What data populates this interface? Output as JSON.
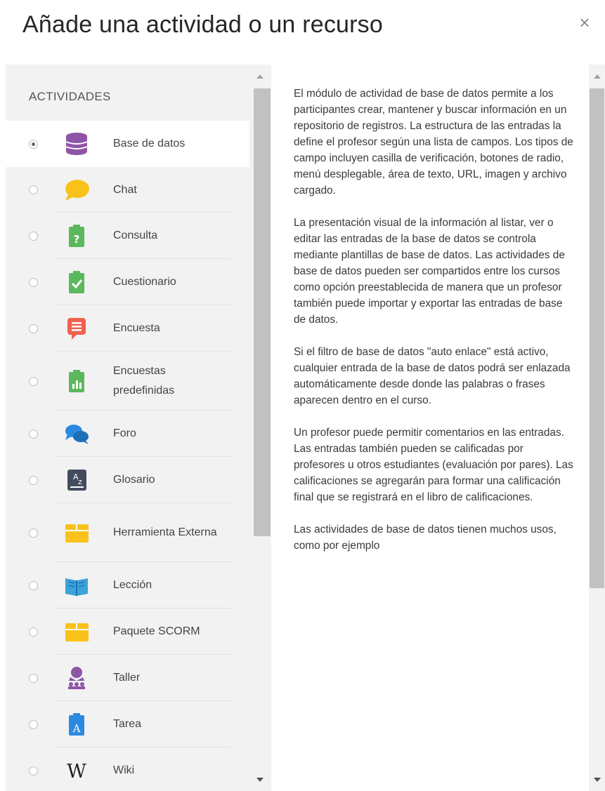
{
  "modal": {
    "title": "Añade una actividad o un recurso",
    "close_symbol": "×"
  },
  "activities": {
    "heading": "ACTIVIDADES",
    "selected_index": 0,
    "items": [
      {
        "label": "Base de datos",
        "icon": "database-icon",
        "color": "#8e55a6"
      },
      {
        "label": "Chat",
        "icon": "chat-bubble-icon",
        "color": "#f9c21b"
      },
      {
        "label": "Consulta",
        "icon": "choice-clipboard-icon",
        "color": "#5cb85c"
      },
      {
        "label": "Cuestionario",
        "icon": "quiz-checkmark-icon",
        "color": "#5cb85c"
      },
      {
        "label": "Encuesta",
        "icon": "feedback-icon",
        "color": "#f0614e"
      },
      {
        "label": "Encuestas predefinidas",
        "icon": "survey-chart-icon",
        "color": "#5cb85c"
      },
      {
        "label": "Foro",
        "icon": "forum-bubbles-icon",
        "color": "#2b8ae0"
      },
      {
        "label": "Glosario",
        "icon": "glossary-az-icon",
        "color": "#434c5e"
      },
      {
        "label": "Herramienta Externa",
        "icon": "external-tool-box-icon",
        "color": "#f9c21b"
      },
      {
        "label": "Lección",
        "icon": "lesson-book-icon",
        "color": "#3ba3d8"
      },
      {
        "label": "Paquete SCORM",
        "icon": "scorm-box-icon",
        "color": "#f9c21b"
      },
      {
        "label": "Taller",
        "icon": "workshop-people-icon",
        "color": "#8e55a6"
      },
      {
        "label": "Tarea",
        "icon": "assignment-icon",
        "color": "#2b8ae0"
      },
      {
        "label": "Wiki",
        "icon": "wiki-w-icon",
        "color": "#222222"
      }
    ]
  },
  "description": {
    "paragraphs": [
      "El módulo de actividad de base de datos permite a los participantes crear, mantener y buscar información en un repositorio de registros. La estructura de las entradas la define el profesor según una lista de campos. Los tipos de campo incluyen casilla de verificación, botones de radio, menú desplegable, área de texto, URL, imagen y archivo cargado.",
      "La presentación visual de la información al listar, ver o editar las entradas de la base de datos se controla mediante plantillas de base de datos. Las actividades de base de datos pueden ser compartidos entre los cursos como opción preestablecida de manera que un profesor también puede importar y exportar las entradas de base de datos.",
      "Si el filtro de base de datos \"auto enlace\" está activo, cualquier entrada de la base de datos podrá ser enlazada automáticamente desde donde las palabras o frases aparecen dentro en el curso.",
      "Un profesor puede permitir comentarios en las entradas. Las entradas también pueden se calificadas por profesores u otros estudiantes (evaluación por pares). Las calificaciones se agregarán para formar una calificación final que se registrará en el libro de calificaciones.",
      "Las actividades de base de datos tienen muchos usos, como por ejemplo"
    ]
  },
  "colors": {
    "panel_bg": "#f2f2f2",
    "selected_bg": "#ffffff",
    "scroll_thumb": "#c1c1c1"
  }
}
